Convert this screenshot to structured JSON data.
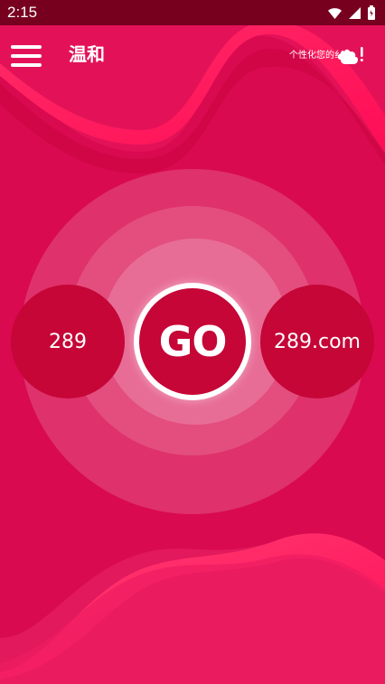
{
  "status_bar": {
    "time": "2:15"
  },
  "toolbar": {
    "title": "温和",
    "banner_text": "个性化您的纟"
  },
  "main": {
    "left_label": "289",
    "center_label": "GO",
    "right_label": "289.com"
  },
  "colors": {
    "background": "#d90a4f",
    "status_bar": "#77001f",
    "circle": "#c50637",
    "accent_wave": "#ff1f5d"
  },
  "icons": {
    "menu": "hamburger-menu-icon",
    "wifi": "wifi-icon",
    "signal": "signal-icon",
    "battery": "battery-icon",
    "banner": "puzzle-alert-icon"
  }
}
